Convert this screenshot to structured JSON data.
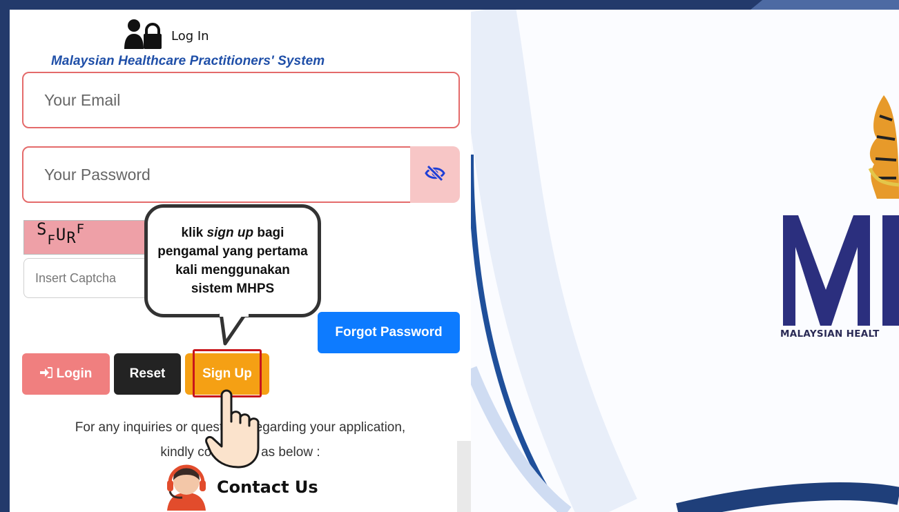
{
  "header": {
    "title": "Log In",
    "system_name": "Malaysian Healthcare Practitioners' System"
  },
  "form": {
    "email_placeholder": "Your Email",
    "password_placeholder": "Your Password",
    "captcha_text": "SFURF",
    "captcha_placeholder": "Insert Captcha"
  },
  "buttons": {
    "forgot_password": "Forgot Password",
    "login": "Login",
    "reset": "Reset",
    "sign_up": "Sign Up"
  },
  "callout": {
    "line1": "klik ",
    "emphasis": "sign up",
    "line1_end": " bagi",
    "rest": "pengamal yang pertama kali menggunakan sistem MHPS"
  },
  "inquiry": {
    "line1": "For any inquiries or questions regarding your application,",
    "line2": "kindly contact us as below :"
  },
  "contact": {
    "label": "Contact Us"
  },
  "branding": {
    "logo_letters": "MH",
    "caption": "MALAYSIAN HEALT"
  },
  "colors": {
    "frame": "#233a6b",
    "accent_blue": "#0d7bff",
    "signup_orange": "#f5a014",
    "login_pink": "#f07f7f",
    "highlight_red": "#c8151b",
    "field_border": "#e46a6a",
    "logo_navy": "#2b2f7e"
  },
  "icons": {
    "header": "user-lock-icon",
    "password_toggle": "eye-slash-icon",
    "login": "sign-in-icon",
    "contact": "headset-agent-icon",
    "pointer": "pointing-hand-icon"
  }
}
